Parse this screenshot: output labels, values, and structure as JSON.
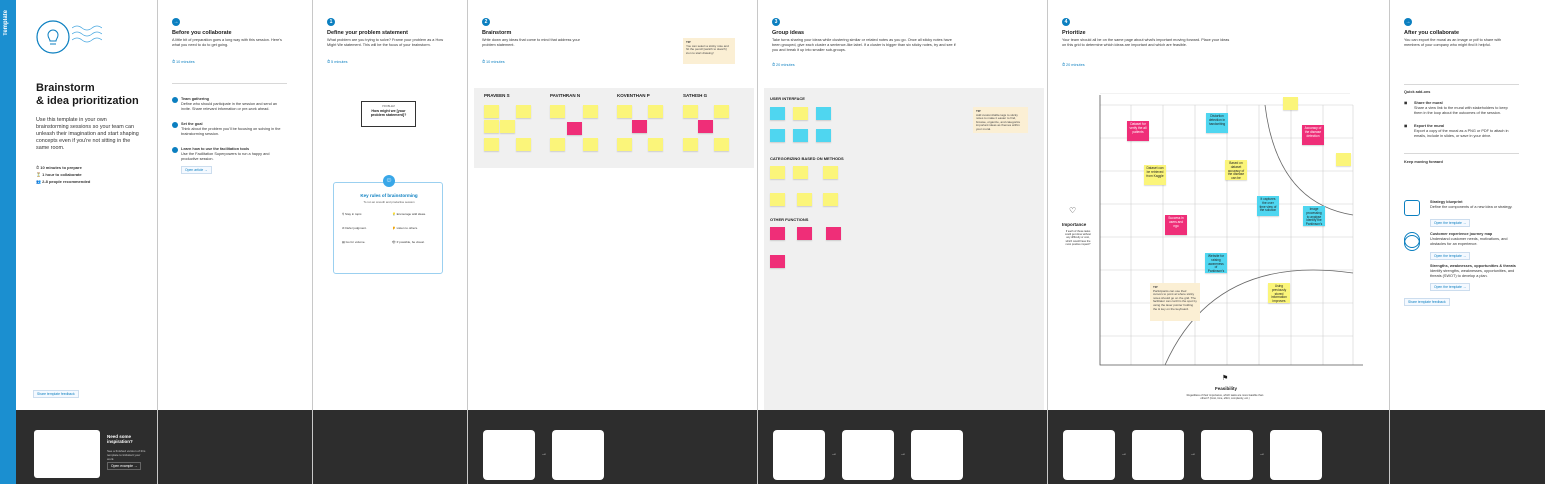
{
  "sidebar_tag": "Template",
  "intro": {
    "title1": "Brainstorm",
    "title2": "& idea prioritization",
    "desc": "Use this template in your own brainstorming sessions so your team can unleash their imagination and start shaping concepts even if you're not sitting in the same room.",
    "meta1": "10 minutes to prepare",
    "meta2": "1 hour to collaborate",
    "meta3": "2-8 people recommended",
    "feedback": "Share template feedback"
  },
  "before": {
    "title": "Before you collaborate",
    "desc": "A little bit of preparation goes a long way with this session. Here's what you need to do to get going.",
    "time": "10 minutes",
    "step1_t": "Team gathering",
    "step1_d": "Define who should participate in the session and send an invite. Share relevant information or pre-work ahead.",
    "step2_t": "Set the goal",
    "step2_d": "Think about the problem you'll be focusing on solving in the brainstorming session.",
    "step3_t": "Learn how to use the facilitation tools",
    "step3_d": "Use the Facilitation Superpowers to run a happy and productive session.",
    "open": "Open article"
  },
  "step1": {
    "n": "1",
    "title": "Define your problem statement",
    "desc": "What problem are you trying to solve? Frame your problem as a How Might We statement. This will be the focus of your brainstorm.",
    "time": "5 minutes",
    "card_label": "PROBLEM",
    "card_text": "How might we [your problem statement]?",
    "rules_title": "Key rules of brainstorming",
    "rules_sub": "To run an smooth and productive session",
    "r1": "Stay in topic.",
    "r2": "Encourage wild ideas.",
    "r3": "Defer judgment.",
    "r4": "Listen to others.",
    "r5": "Go for volume.",
    "r6": "If possible, be visual."
  },
  "step2": {
    "n": "2",
    "title": "Brainstorm",
    "desc": "Write down any ideas that come to mind that address your problem statement.",
    "time": "10 minutes",
    "tip": "You can select a sticky note and hit the pencil [switch to sketch] icon to start drawing!",
    "names": [
      "PRAVEEN S",
      "PAVITHRAN N",
      "KOVENTHAN P",
      "SATHISH G"
    ]
  },
  "step3": {
    "n": "3",
    "title": "Group ideas",
    "desc": "Take turns sharing your ideas while clustering similar or related notes as you go. Once all sticky notes have been grouped, give each cluster a sentence-like label. If a cluster is bigger than six sticky notes, try and see if you and break it up into smaller sub-groups.",
    "time": "20 minutes",
    "g1": "USER INTERFACE",
    "g2": "CATEGORIZING BASED ON METHODS",
    "g3": "OTHER FUNCTIONS",
    "tip": "Add customizable tags to sticky notes to make it easier to find, browse, organize, and categorize important ideas as themes within your mural."
  },
  "step4": {
    "n": "4",
    "title": "Prioritize",
    "desc": "Your team should all be on the same page about what's important moving forward. Place your ideas on this grid to determine which ideas are important and which are feasible.",
    "time": "20 minutes",
    "ylabel": "Importance",
    "ysub": "If each of these tasks could get done without any difficulty or cost, which would have the most positive impact?",
    "xlabel": "Feasibility",
    "xsub": "Regardless of their importance, which tasks are more feasible than others? (Cost, time, effort, complexity, etc.)",
    "tip": "Participants can use their cursors to point at where sticky notes should go on the grid. The facilitator can confirm the spot by using the laser pointer holding the H key on the keyboard.",
    "n1": "Dataset for verify the all patients",
    "n2": "Distortion detection in handwriting",
    "n3": "Dataset can be retrieved from Kaggle",
    "n4": "Based on dataset accuracy of the disease can be detected",
    "n5": "Accuracy of the disease detection",
    "n6": "It captures the over time view of the solution",
    "n7": "Image processing to analyse identify the Parkinson's disease",
    "n8": "Success in users and ngo",
    "n9": "Website for raising awareness of Parkinson's disease",
    "n10": "Using previously stored information improves accuracy"
  },
  "after": {
    "title": "After you collaborate",
    "desc": "You can export the mural as an image or pdf to share with members of your company who might find it helpful.",
    "qa": "Quick add-ons",
    "a1": "Share the mural",
    "a1d": "Share a view link to the mural with stakeholders to keep them in the loop about the outcomes of the session.",
    "a2": "Export the mural",
    "a2d": "Export a copy of the mural as a PNG or PDF to attach in emails, include in slides, or save in your drive.",
    "km": "Keep moving forward",
    "k1": "Strategy blueprint",
    "k1d": "Define the components of a new idea or strategy.",
    "k2": "Customer experience journey map",
    "k2d": "Understand customer needs, motivations, and obstacles for an experience.",
    "k3": "Strengths, weaknesses, opportunities & threats",
    "k3d": "Identify strengths, weaknesses, opportunities, and threats (SWOT) to develop a plan.",
    "open": "Open the template",
    "feedback": "Share template feedback"
  },
  "inspo": {
    "title": "Need some inspiration?",
    "desc": "See a finished version of this template to kickstart your work.",
    "btn": "Open example"
  }
}
